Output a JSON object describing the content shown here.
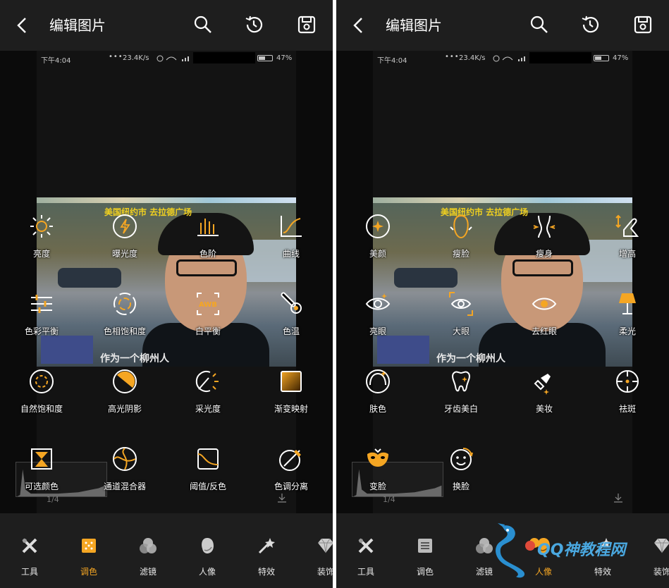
{
  "colors": {
    "accent": "#f5a623",
    "bar": "#1e1e1e",
    "icon": "#ffffff"
  },
  "left": {
    "title": "编辑图片",
    "status": {
      "time": "下午4:04",
      "dots": "•••",
      "speed": "23.4K/s",
      "battery": "47%"
    },
    "video": {
      "caption_top": "美国纽约市 去拉德广场",
      "caption_bottom": "作为一个柳州人"
    },
    "pager": "1/4",
    "tools": [
      {
        "label": "亮度",
        "icon": "sun-icon"
      },
      {
        "label": "曝光度",
        "icon": "exposure-icon"
      },
      {
        "label": "色阶",
        "icon": "levels-icon"
      },
      {
        "label": "曲线",
        "icon": "curves-icon"
      },
      {
        "label": "色彩平衡",
        "icon": "sliders-icon"
      },
      {
        "label": "色相饱和度",
        "icon": "hue-icon"
      },
      {
        "label": "白平衡",
        "icon": "awb-icon",
        "badge": "AWB"
      },
      {
        "label": "色温",
        "icon": "thermometer-icon"
      },
      {
        "label": "自然饱和度",
        "icon": "vibrance-icon"
      },
      {
        "label": "高光阴影",
        "icon": "highlight-icon"
      },
      {
        "label": "采光度",
        "icon": "lighting-icon"
      },
      {
        "label": "渐变映射",
        "icon": "gradient-map-icon"
      },
      {
        "label": "可选颜色",
        "icon": "selective-color-icon"
      },
      {
        "label": "通道混合器",
        "icon": "channel-mixer-icon"
      },
      {
        "label": "阈值/反色",
        "icon": "threshold-icon"
      },
      {
        "label": "色调分离",
        "icon": "posterize-icon"
      }
    ],
    "categories": [
      {
        "label": "工具",
        "icon": "tools-icon"
      },
      {
        "label": "调色",
        "icon": "color-icon",
        "active": true
      },
      {
        "label": "滤镜",
        "icon": "filter-icon"
      },
      {
        "label": "人像",
        "icon": "portrait-icon"
      },
      {
        "label": "特效",
        "icon": "effects-icon"
      },
      {
        "label": "装饰",
        "icon": "diamond-icon"
      }
    ]
  },
  "right": {
    "title": "编辑图片",
    "status": {
      "time": "下午4:04",
      "dots": "•••",
      "speed": "23.4K/s",
      "battery": "47%"
    },
    "video": {
      "caption_top": "美国纽约市 去拉德广场",
      "caption_bottom": "作为一个柳州人"
    },
    "pager": "1/4",
    "tools": [
      {
        "label": "美颜",
        "icon": "sparkle-face-icon"
      },
      {
        "label": "瘦脸",
        "icon": "face-slim-icon"
      },
      {
        "label": "瘦身",
        "icon": "body-slim-icon"
      },
      {
        "label": "增高",
        "icon": "heel-icon"
      },
      {
        "label": "亮眼",
        "icon": "bright-eye-icon"
      },
      {
        "label": "大眼",
        "icon": "big-eye-icon"
      },
      {
        "label": "去红眼",
        "icon": "red-eye-icon"
      },
      {
        "label": "柔光",
        "icon": "lamp-icon"
      },
      {
        "label": "肤色",
        "icon": "skin-icon"
      },
      {
        "label": "牙齿美白",
        "icon": "tooth-icon"
      },
      {
        "label": "美妆",
        "icon": "lipstick-icon"
      },
      {
        "label": "祛斑",
        "icon": "target-icon"
      },
      {
        "label": "变脸",
        "icon": "mask-icon"
      },
      {
        "label": "换脸",
        "icon": "face-swap-icon"
      }
    ],
    "categories": [
      {
        "label": "工具",
        "icon": "tools-icon"
      },
      {
        "label": "调色",
        "icon": "color-icon"
      },
      {
        "label": "滤镜",
        "icon": "filter-icon"
      },
      {
        "label": "人像",
        "icon": "portrait-icon",
        "active": true
      },
      {
        "label": "特效",
        "icon": "effects-icon"
      },
      {
        "label": "装饰",
        "icon": "diamond-icon"
      }
    ]
  },
  "watermark": {
    "text": "QQ神教程网"
  }
}
